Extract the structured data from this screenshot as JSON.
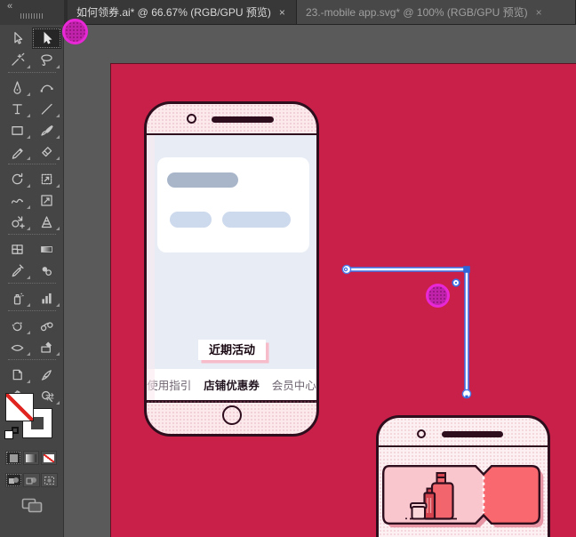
{
  "tabs": [
    {
      "title": "如何领券.ai* @ 66.67% (RGB/GPU 预览)",
      "close_glyph": "×",
      "zoom": "66.67%",
      "active": true
    },
    {
      "title": "23.-mobile app.svg* @ 100% (RGB/GPU 预览)",
      "close_glyph": "×",
      "zoom": "100%",
      "active": false
    }
  ],
  "toolbar": {
    "collapse_glyph": "«",
    "active_tool": "direct-selection",
    "tool_rows": [
      [
        "selection",
        "direct-selection"
      ],
      [
        "magic-wand",
        "lasso"
      ],
      [
        "pen",
        "curvature"
      ],
      [
        "type",
        "line-segment"
      ],
      [
        "rectangle",
        "paintbrush"
      ],
      [
        "pencil",
        "eraser"
      ],
      [
        "rotate",
        "scale"
      ],
      [
        "warp",
        "free-transform"
      ],
      [
        "shape-builder",
        "perspective-grid"
      ],
      [
        "mesh",
        "gradient"
      ],
      [
        "eyedropper",
        "live-paint-bucket"
      ],
      [
        "symbol-sprayer",
        "column-graph"
      ],
      [
        "reshape",
        "blend"
      ],
      [
        "width",
        "slice"
      ],
      [
        "artboard",
        "knife"
      ],
      [
        "hand",
        "zoom"
      ]
    ],
    "dividers_after_rows": [
      2,
      6,
      9,
      11,
      12,
      14
    ],
    "swap_glyph": "⇄"
  },
  "artboard": {
    "background": "#c82048"
  },
  "phone1": {
    "activity_label": "近期活动",
    "nav_items": [
      {
        "label": "使用指引",
        "active": false
      },
      {
        "label": "店铺优惠券",
        "active": true
      },
      {
        "label": "会员中心",
        "active": false
      }
    ]
  },
  "colors": {
    "artboard_red": "#c82048",
    "outline_dark": "#2e0d1d",
    "phone_pink": "#fbe9ec",
    "screen_gray": "#e8edf5",
    "pill_dark": "#a9b6ca",
    "pill_light": "#cdd9ec",
    "coupon_pink": "#f9c6cd",
    "coupon_coral": "#f8686e",
    "bottle_coral": "#f2656c",
    "bottle_dark_red": "#d5444e",
    "selection_blue": "#3a72e8",
    "cursor_magenta": "#e828d6"
  }
}
